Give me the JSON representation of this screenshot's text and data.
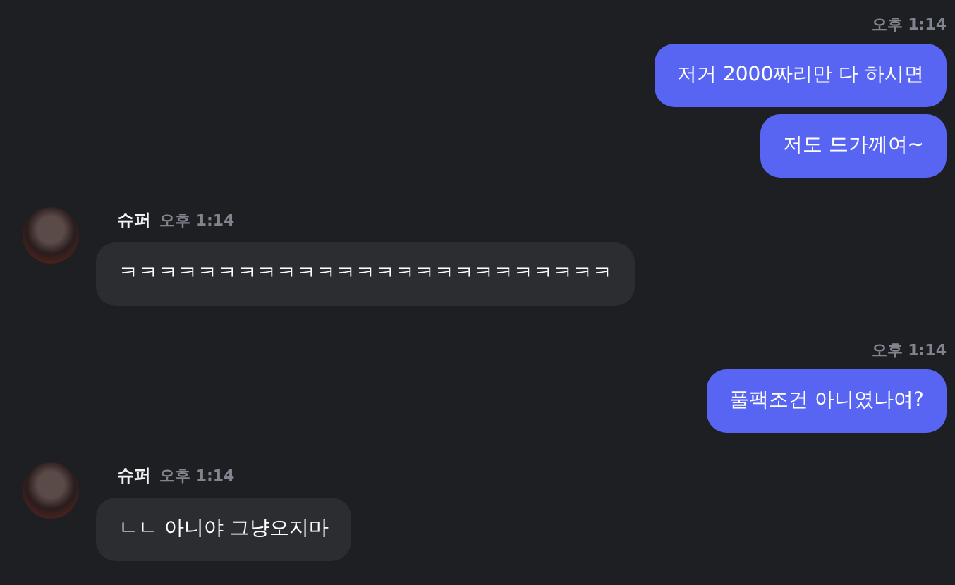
{
  "messages": [
    {
      "kind": "outgoing",
      "time": "오후 1:14",
      "bubbles": [
        "저거 2000짜리만 다 하시면",
        "저도 드가께여~"
      ]
    },
    {
      "kind": "incoming",
      "author": "슈퍼",
      "time": "오후 1:14",
      "bubbles": [
        "ㅋㅋㅋㅋㅋㅋㅋㅋㅋㅋㅋㅋㅋㅋㅋㅋㅋㅋㅋㅋㅋㅋㅋㅋㅋ"
      ]
    },
    {
      "kind": "outgoing",
      "time": "오후 1:14",
      "bubbles": [
        "풀팩조건 아니였나여?"
      ]
    },
    {
      "kind": "incoming",
      "author": "슈퍼",
      "time": "오후 1:14",
      "bubbles": [
        "ㄴㄴ 아니야 그냥오지마"
      ]
    }
  ]
}
